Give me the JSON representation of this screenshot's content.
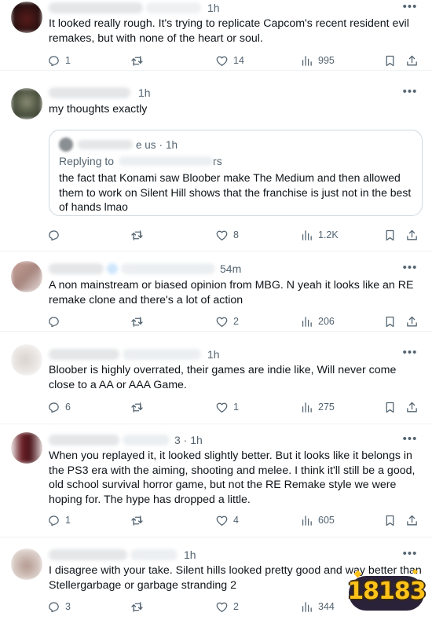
{
  "posts": [
    {
      "time": "1h",
      "text": "It looked really rough. It's trying to replicate Capcom's recent resident evil remakes, but with none of the heart or soul.",
      "reply_count": "1",
      "repost_count": "",
      "like_count": "14",
      "view_count": "995"
    },
    {
      "time": "1h",
      "text": "my thoughts exactly",
      "quote": {
        "handle_fragment": "e us",
        "time": "1h",
        "replying_to_label": "Replying to",
        "replying_to_handle_fragment": "rs",
        "text": "the fact that Konami saw Bloober make The Medium and then allowed them to work on Silent Hill shows that the franchise is just not in the best of hands lmao"
      },
      "reply_count": "",
      "repost_count": "",
      "like_count": "8",
      "view_count": "1.2K"
    },
    {
      "time": "54m",
      "text": "A non mainstream or biased opinion from MBG. N yeah it looks like an RE remake clone and there's a lot of action",
      "reply_count": "",
      "repost_count": "",
      "like_count": "2",
      "view_count": "206"
    },
    {
      "time": "1h",
      "text": "Bloober is highly overrated, their games are indie like, Will never come close to a AA or AAA Game.",
      "reply_count": "6",
      "repost_count": "",
      "like_count": "1",
      "view_count": "275"
    },
    {
      "time": "3 · 1h",
      "text": "When you replayed it, it looked slightly better.  But it looks like it belongs in the PS3 era with the aiming, shooting and melee.  I think it'll still be a good, old school survival horror game, but not the RE Remake style we were hoping for.  The hype has dropped a little.",
      "reply_count": "1",
      "repost_count": "",
      "like_count": "4",
      "view_count": "605"
    },
    {
      "time": "1h",
      "text": "I disagree with your take. Silent hills looked pretty good and way better than Stellergarbage or garbage stranding 2",
      "reply_count": "3",
      "repost_count": "",
      "like_count": "2",
      "view_count": "344"
    }
  ],
  "ui": {
    "more_glyph": "•••",
    "separator": "·"
  },
  "icons": {
    "reply": "reply-icon",
    "repost": "repost-icon",
    "like": "heart-icon",
    "views": "views-icon",
    "bookmark": "bookmark-icon",
    "share": "share-icon"
  },
  "watermark": {
    "text": "18183"
  },
  "colors": {
    "text": "#0f1419",
    "muted": "#536471",
    "border": "#cfd9de",
    "divider": "#eff3f4"
  }
}
